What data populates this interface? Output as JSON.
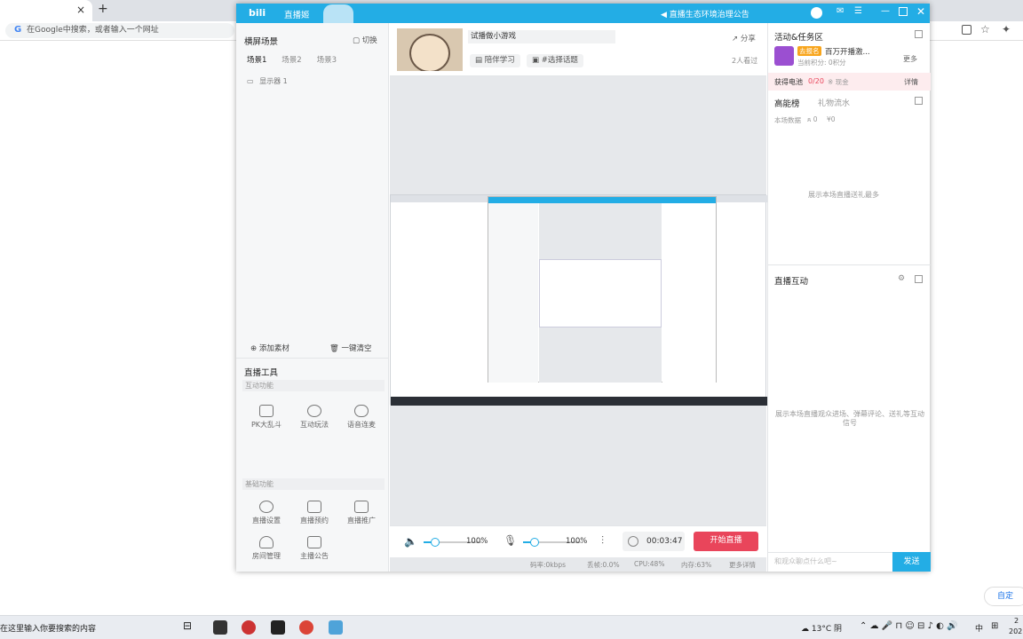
{
  "browser": {
    "omnibox_placeholder": "在Google中搜索，或者输入一个网址",
    "google_g": "G",
    "close_tab": "×",
    "new_tab": "+"
  },
  "app": {
    "title": "直播姬",
    "announcement": "直播生态环境治理公告",
    "left": {
      "scene_title": "横屏场景",
      "switch_label": "切换",
      "scene_tabs": [
        "场景1",
        "场景2",
        "场景3"
      ],
      "sources": [
        "显示器 1"
      ],
      "add_source": "添加素材",
      "clear_all": "一键清空",
      "tools_title": "直播工具",
      "interactive_label": "互动功能",
      "interactive_tools": [
        "PK大乱斗",
        "互动玩法",
        "语音连麦"
      ],
      "basic_label": "基础功能",
      "basic_tools": [
        "直播设置",
        "直播预约",
        "直播推广",
        "房间管理",
        "主播公告"
      ]
    },
    "header": {
      "stream_title": "试播做小游戏",
      "share": "分享",
      "category": "陪伴学习",
      "topic": "#选择话题",
      "viewers": "2人看过"
    },
    "controls": {
      "speaker_volume": "100%",
      "mic_volume": "100%",
      "timer": "00:03:47",
      "start_live": "开始直播",
      "speaker_level": 0.2,
      "mic_level": 0.2
    },
    "status": {
      "bitrate": "码率:0kbps",
      "drop": "丢帧:0.0%",
      "cpu": "CPU:48%",
      "memory": "内存:63%",
      "more": "更多详情"
    },
    "right": {
      "activity_title": "活动&任务区",
      "promo_badge": "去报名",
      "promo_text": "百万开播激...",
      "promo_sub": "当前积分: 0积分",
      "more": "更多",
      "battery": "获得电池",
      "battery_count": "0/20",
      "battery_gold": "※ 现金",
      "details": "详情",
      "rank_tab1": "高能榜",
      "rank_tab2": "礼物流水",
      "stats_label": "本场数据",
      "stats_people": "0",
      "stats_money": "¥0",
      "rank_empty": "展示本场直播送礼最多",
      "interaction_title": "直播互动",
      "interaction_empty": "展示本场直播观众进场、弹幕评论、送礼等互动信号",
      "chat_placeholder": "和观众聊点什么吧~",
      "send": "发送"
    }
  },
  "page": {
    "customize": "自定"
  },
  "taskbar": {
    "search_placeholder": "在这里输入你要搜索的内容",
    "weather": "13°C 阴",
    "ime": "中",
    "time": "2",
    "date": "202"
  }
}
